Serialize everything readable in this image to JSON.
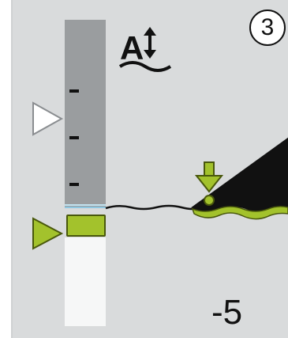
{
  "step": {
    "number": "3"
  },
  "depth": {
    "value": "-5"
  },
  "icons": {
    "adjust": "text-height-adjust-icon",
    "reference_marker": "white-triangle-marker",
    "current_marker": "green-triangle-marker",
    "drop_arrow": "down-arrow-icon"
  },
  "colors": {
    "accent_green": "#a3c22c",
    "scale_gray": "#9a9d9f",
    "hull_black": "#111111"
  }
}
